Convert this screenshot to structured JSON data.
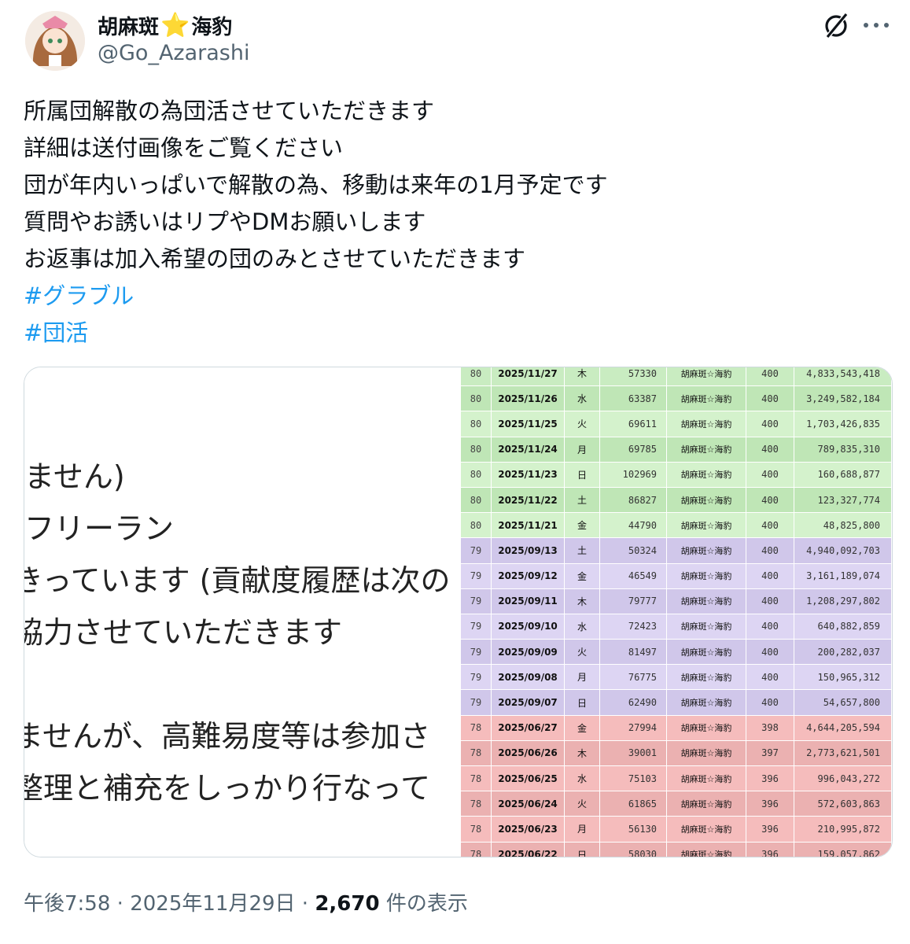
{
  "author": {
    "display_name_part1": "胡麻斑",
    "display_name_star": "⭐",
    "display_name_part2": "海豹",
    "handle": "@Go_Azarashi"
  },
  "icons": {
    "grok": "grok-icon",
    "more": "more-options-icon",
    "avatar": "avatar-image"
  },
  "tweet": {
    "lines": [
      "所属団解散の為団活させていただきます",
      "詳細は送付画像をご覧ください",
      "団が年内いっぱいで解散の為、移動は来年の1月予定です",
      "質問やお誘いはリプやDMお願いします",
      "お返事は加入希望の団のみとさせていただきます"
    ],
    "hashtags": [
      "#グラブル",
      "#団活"
    ]
  },
  "media": {
    "left_text": [
      "ません)",
      "フリーラン",
      "きっています (貢献度履歴は次の",
      "協力させていただきます",
      "ませんが、高難易度等は参加さ",
      "整理と補充をしっかり行なって"
    ],
    "rows": [
      {
        "lvl": "80",
        "date": "2025/11/27",
        "day": "木",
        "num": "57330",
        "name": "胡麻斑☆海豹",
        "cnt": "400",
        "total": "4,833,543,418",
        "color": "#c9ecc1"
      },
      {
        "lvl": "80",
        "date": "2025/11/26",
        "day": "水",
        "num": "63387",
        "name": "胡麻斑☆海豹",
        "cnt": "400",
        "total": "3,249,582,184",
        "color": "#bfe6b6"
      },
      {
        "lvl": "80",
        "date": "2025/11/25",
        "day": "火",
        "num": "69611",
        "name": "胡麻斑☆海豹",
        "cnt": "400",
        "total": "1,703,426,835",
        "color": "#d4f2cc"
      },
      {
        "lvl": "80",
        "date": "2025/11/24",
        "day": "月",
        "num": "69785",
        "name": "胡麻斑☆海豹",
        "cnt": "400",
        "total": "789,835,310",
        "color": "#bfe6b6"
      },
      {
        "lvl": "80",
        "date": "2025/11/23",
        "day": "日",
        "num": "102969",
        "name": "胡麻斑☆海豹",
        "cnt": "400",
        "total": "160,688,877",
        "color": "#d4f2cc"
      },
      {
        "lvl": "80",
        "date": "2025/11/22",
        "day": "土",
        "num": "86827",
        "name": "胡麻斑☆海豹",
        "cnt": "400",
        "total": "123,327,774",
        "color": "#bfe6b6"
      },
      {
        "lvl": "80",
        "date": "2025/11/21",
        "day": "金",
        "num": "44790",
        "name": "胡麻斑☆海豹",
        "cnt": "400",
        "total": "48,825,800",
        "color": "#d4f2cc"
      },
      {
        "lvl": "79",
        "date": "2025/09/13",
        "day": "土",
        "num": "50324",
        "name": "胡麻斑☆海豹",
        "cnt": "400",
        "total": "4,940,092,703",
        "color": "#d0c7ea"
      },
      {
        "lvl": "79",
        "date": "2025/09/12",
        "day": "金",
        "num": "46549",
        "name": "胡麻斑☆海豹",
        "cnt": "400",
        "total": "3,161,189,074",
        "color": "#ddd5f3"
      },
      {
        "lvl": "79",
        "date": "2025/09/11",
        "day": "木",
        "num": "79777",
        "name": "胡麻斑☆海豹",
        "cnt": "400",
        "total": "1,208,297,802",
        "color": "#d0c7ea"
      },
      {
        "lvl": "79",
        "date": "2025/09/10",
        "day": "水",
        "num": "72423",
        "name": "胡麻斑☆海豹",
        "cnt": "400",
        "total": "640,882,859",
        "color": "#ddd5f3"
      },
      {
        "lvl": "79",
        "date": "2025/09/09",
        "day": "火",
        "num": "81497",
        "name": "胡麻斑☆海豹",
        "cnt": "400",
        "total": "200,282,037",
        "color": "#d0c7ea"
      },
      {
        "lvl": "79",
        "date": "2025/09/08",
        "day": "月",
        "num": "76775",
        "name": "胡麻斑☆海豹",
        "cnt": "400",
        "total": "150,965,312",
        "color": "#ddd5f3"
      },
      {
        "lvl": "79",
        "date": "2025/09/07",
        "day": "日",
        "num": "62490",
        "name": "胡麻斑☆海豹",
        "cnt": "400",
        "total": "54,657,800",
        "color": "#d0c7ea"
      },
      {
        "lvl": "78",
        "date": "2025/06/27",
        "day": "金",
        "num": "27994",
        "name": "胡麻斑☆海豹",
        "cnt": "398",
        "total": "4,644,205,594",
        "color": "#f5bcbc"
      },
      {
        "lvl": "78",
        "date": "2025/06/26",
        "day": "木",
        "num": "39001",
        "name": "胡麻斑☆海豹",
        "cnt": "397",
        "total": "2,773,621,501",
        "color": "#ebb1b1"
      },
      {
        "lvl": "78",
        "date": "2025/06/25",
        "day": "水",
        "num": "75103",
        "name": "胡麻斑☆海豹",
        "cnt": "396",
        "total": "996,043,272",
        "color": "#f5bcbc"
      },
      {
        "lvl": "78",
        "date": "2025/06/24",
        "day": "火",
        "num": "61865",
        "name": "胡麻斑☆海豹",
        "cnt": "396",
        "total": "572,603,863",
        "color": "#ebb1b1"
      },
      {
        "lvl": "78",
        "date": "2025/06/23",
        "day": "月",
        "num": "56130",
        "name": "胡麻斑☆海豹",
        "cnt": "396",
        "total": "210,995,872",
        "color": "#f5bcbc"
      },
      {
        "lvl": "78",
        "date": "2025/06/22",
        "day": "日",
        "num": "58030",
        "name": "胡麻斑☆海豹",
        "cnt": "396",
        "total": "159,057,862",
        "color": "#ebb1b1"
      }
    ]
  },
  "footer": {
    "time": "午後7:58",
    "sep1": " · ",
    "date": "2025年11月29日",
    "sep2": " · ",
    "views_count": "2,670",
    "views_label": " 件の表示"
  }
}
